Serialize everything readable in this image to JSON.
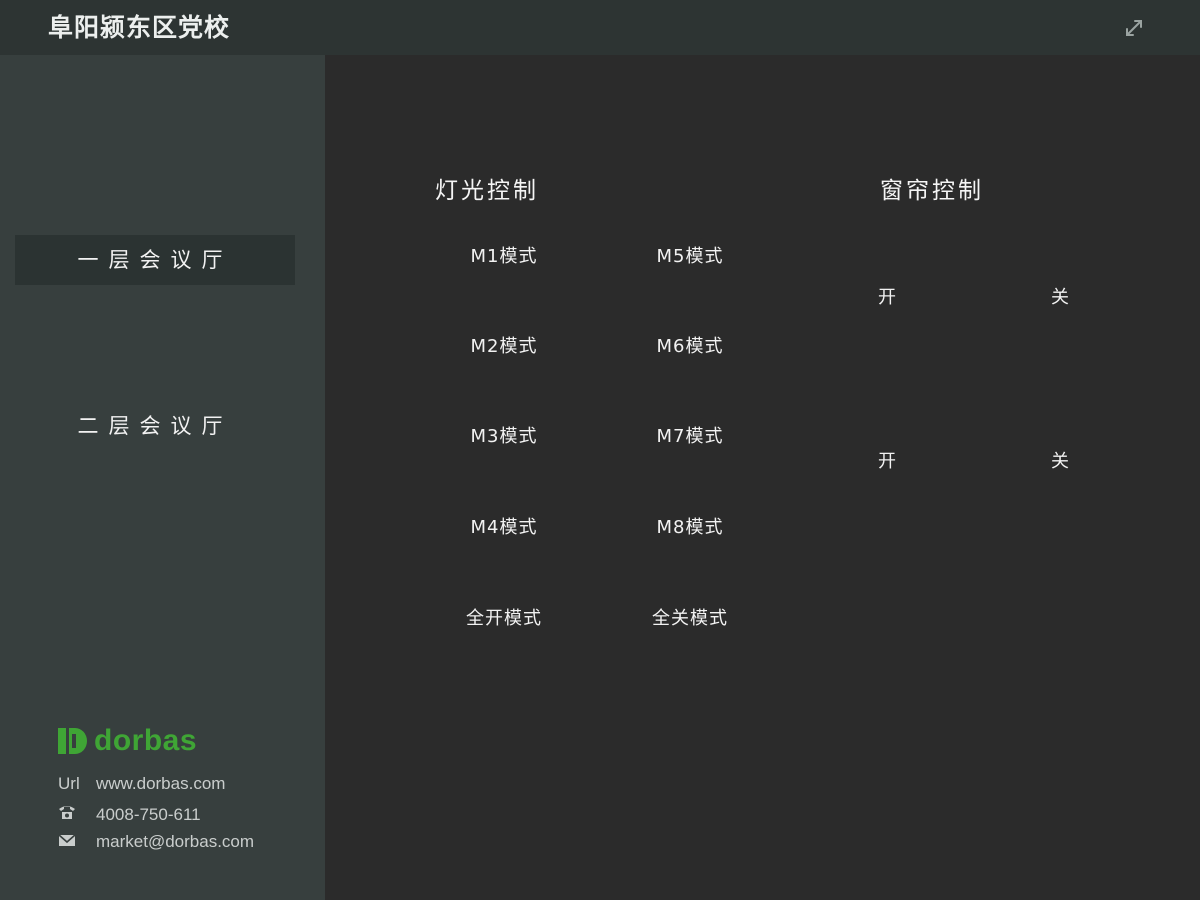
{
  "header": {
    "title": "阜阳颍东区党校",
    "expand_icon": "expand-icon"
  },
  "sidebar": {
    "items": [
      {
        "label": "一层会议厅",
        "active": true
      },
      {
        "label": "二层会议厅",
        "active": false
      }
    ],
    "brand": {
      "logo_text": "dorbas",
      "color": "#3fa535"
    },
    "contact": {
      "url_label": "Url",
      "url": "www.dorbas.com",
      "phone": "4008-750-611",
      "email": "market@dorbas.com"
    }
  },
  "lighting": {
    "title": "灯光控制",
    "modes": [
      "M1模式",
      "M5模式",
      "M2模式",
      "M6模式",
      "M3模式",
      "M7模式",
      "M4模式",
      "M8模式",
      "全开模式",
      "全关模式"
    ]
  },
  "curtain": {
    "title": "窗帘控制",
    "rows": [
      {
        "open": "开",
        "close": "关"
      },
      {
        "open": "开",
        "close": "关"
      }
    ]
  }
}
